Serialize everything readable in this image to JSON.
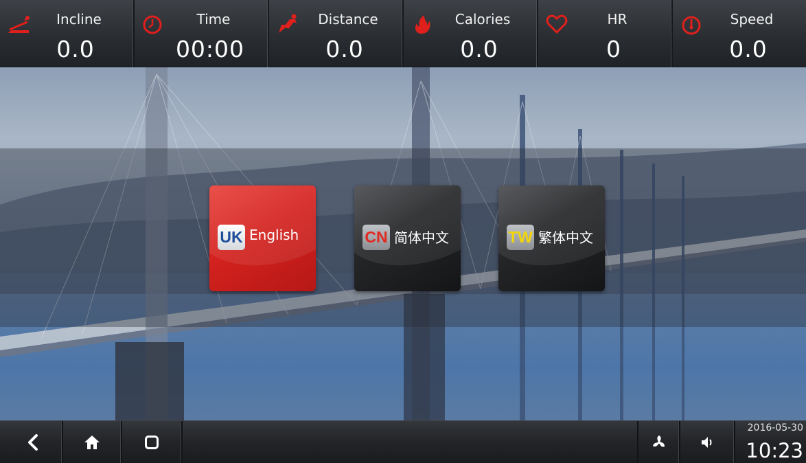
{
  "metrics": [
    {
      "label": "Incline",
      "value": "0.0",
      "icon": "incline-icon"
    },
    {
      "label": "Time",
      "value": "00:00",
      "icon": "clock-icon"
    },
    {
      "label": "Distance",
      "value": "0.0",
      "icon": "runner-icon"
    },
    {
      "label": "Calories",
      "value": "0.0",
      "icon": "flame-icon"
    },
    {
      "label": "HR",
      "value": "0",
      "icon": "heart-icon"
    },
    {
      "label": "Speed",
      "value": "0.0",
      "icon": "speedometer-icon"
    }
  ],
  "languages": [
    {
      "code": "UK",
      "label": "English",
      "code_color": "#1f4f9a"
    },
    {
      "code": "CN",
      "label": "简体中文",
      "code_color": "#e02a22"
    },
    {
      "code": "TW",
      "label": "繁体中文",
      "code_color": "#f2d60a"
    }
  ],
  "nav": {
    "back_icon": "back-icon",
    "home_icon": "home-icon",
    "recent_icon": "recent-apps-icon",
    "fan_icon": "fan-icon",
    "volume_icon": "volume-icon"
  },
  "status": {
    "date": "2016-05-30",
    "time": "10:23"
  },
  "colors": {
    "metric_icon": "#e0201c",
    "selected_tile": "#d4221f",
    "tile": "#1b1c1e"
  }
}
